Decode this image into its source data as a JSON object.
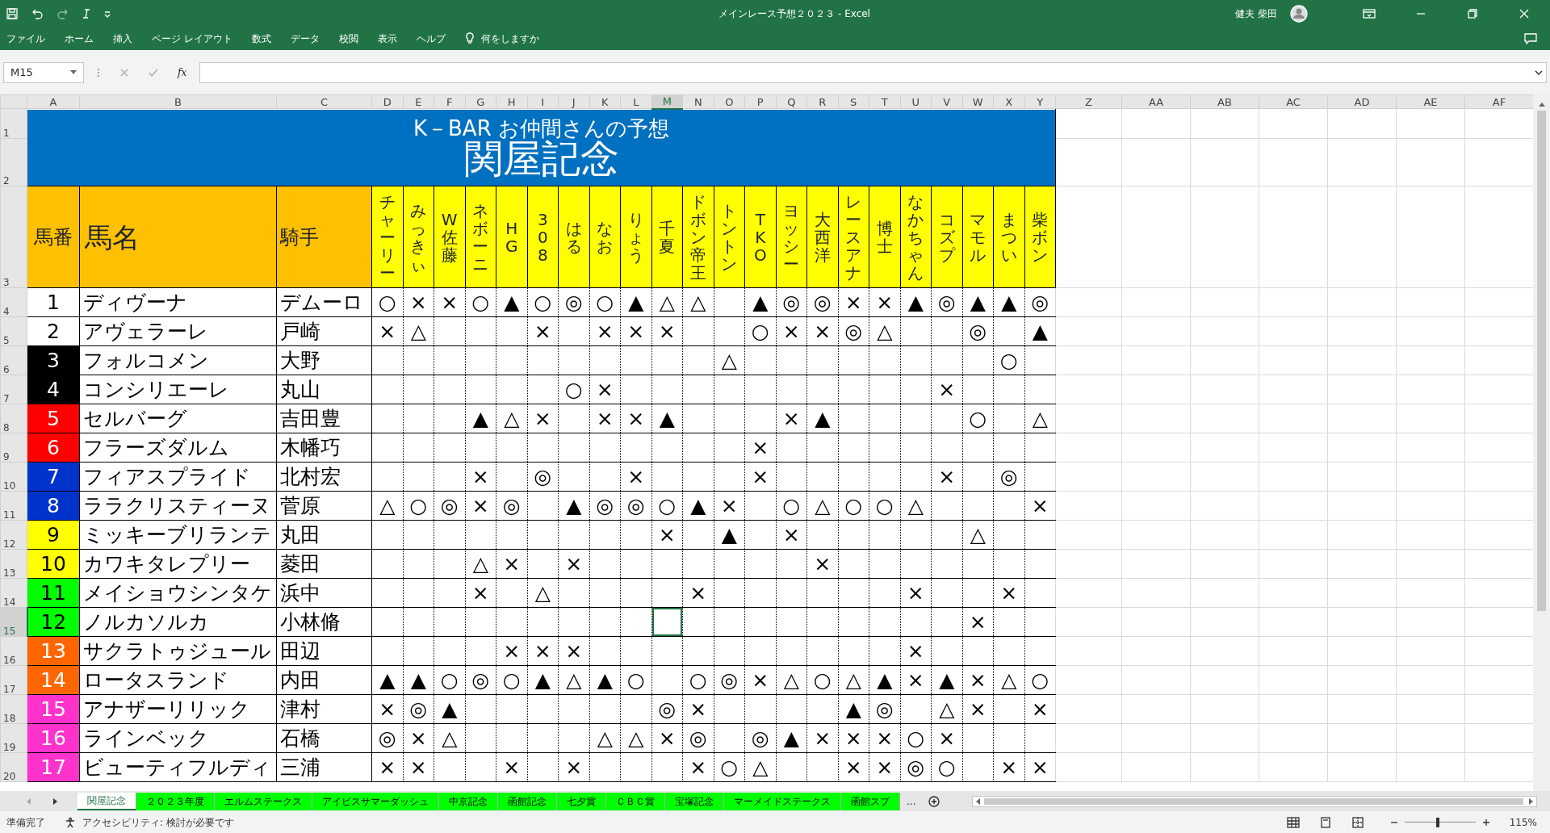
{
  "window": {
    "title": "メインレース予想２０２３ - Excel",
    "user": "健夫 柴田"
  },
  "ribbon_tabs": [
    "ファイル",
    "ホーム",
    "挿入",
    "ページ レイアウト",
    "数式",
    "データ",
    "校閲",
    "表示",
    "ヘルプ"
  ],
  "tell_me": "何をしますか",
  "name_box": "M15",
  "function_label": "fx",
  "columns": [
    {
      "label": "A",
      "selected": false
    },
    {
      "label": "B",
      "selected": false
    },
    {
      "label": "C",
      "selected": false
    },
    {
      "label": "D",
      "selected": false
    },
    {
      "label": "E",
      "selected": false
    },
    {
      "label": "F",
      "selected": false
    },
    {
      "label": "G",
      "selected": false
    },
    {
      "label": "H",
      "selected": false
    },
    {
      "label": "I",
      "selected": false
    },
    {
      "label": "J",
      "selected": false
    },
    {
      "label": "K",
      "selected": false
    },
    {
      "label": "L",
      "selected": false
    },
    {
      "label": "M",
      "selected": true
    },
    {
      "label": "N",
      "selected": false
    },
    {
      "label": "O",
      "selected": false
    },
    {
      "label": "P",
      "selected": false
    },
    {
      "label": "Q",
      "selected": false
    },
    {
      "label": "R",
      "selected": false
    },
    {
      "label": "S",
      "selected": false
    },
    {
      "label": "T",
      "selected": false
    },
    {
      "label": "U",
      "selected": false
    },
    {
      "label": "V",
      "selected": false
    },
    {
      "label": "W",
      "selected": false
    },
    {
      "label": "X",
      "selected": false
    },
    {
      "label": "Y",
      "selected": false
    },
    {
      "label": "Z",
      "selected": false
    },
    {
      "label": "AA",
      "selected": false
    },
    {
      "label": "AB",
      "selected": false
    },
    {
      "label": "AC",
      "selected": false
    },
    {
      "label": "AD",
      "selected": false
    },
    {
      "label": "AE",
      "selected": false
    },
    {
      "label": "AF",
      "selected": false
    }
  ],
  "rows": [
    {
      "label": "1",
      "selected": false
    },
    {
      "label": "2",
      "selected": false
    },
    {
      "label": "3",
      "selected": false
    },
    {
      "label": "4",
      "selected": false
    },
    {
      "label": "5",
      "selected": false
    },
    {
      "label": "6",
      "selected": false
    },
    {
      "label": "7",
      "selected": false
    },
    {
      "label": "8",
      "selected": false
    },
    {
      "label": "9",
      "selected": false
    },
    {
      "label": "10",
      "selected": false
    },
    {
      "label": "11",
      "selected": false
    },
    {
      "label": "12",
      "selected": false
    },
    {
      "label": "13",
      "selected": false
    },
    {
      "label": "14",
      "selected": false
    },
    {
      "label": "15",
      "selected": true
    },
    {
      "label": "16",
      "selected": false
    },
    {
      "label": "17",
      "selected": false
    },
    {
      "label": "18",
      "selected": false
    },
    {
      "label": "19",
      "selected": false
    },
    {
      "label": "20",
      "selected": false
    }
  ],
  "sheet": {
    "title": "K－BAR お仲間さんの予想",
    "subtitle": "関屋記念",
    "headers": {
      "number": "馬番",
      "name": "馬名",
      "jockey": "騎手"
    },
    "predictors": [
      "チャーリー",
      "みっきぃ",
      "W佐藤",
      "ネボーニ",
      "HG",
      "308",
      "はる",
      "なお",
      "りょう",
      "千夏",
      "ドボン帝王",
      "トントン",
      "TKO",
      "ヨッシー",
      "大西洋",
      "レースアナ",
      "博士",
      "なかちゃん",
      "コズプ",
      "マモル",
      "まつい",
      "柴ボン"
    ],
    "horses": [
      {
        "number": "1",
        "name": "ディヴーナ",
        "jockey": "デムーロ",
        "color": "#ffffff",
        "marks": [
          {
            "kind": "mark",
            "text": "○"
          },
          {
            "kind": "mark",
            "text": "×"
          },
          {
            "kind": "mark",
            "text": "×"
          },
          {
            "kind": "mark",
            "text": "○"
          },
          {
            "kind": "mark",
            "text": "▲"
          },
          {
            "kind": "mark",
            "text": "○"
          },
          {
            "kind": "mark",
            "text": "◎"
          },
          {
            "kind": "mark",
            "text": "○"
          },
          {
            "kind": "mark",
            "text": "▲"
          },
          {
            "kind": "mark",
            "text": "△"
          },
          {
            "kind": "mark",
            "text": "△"
          },
          {
            "kind": "blank"
          },
          {
            "kind": "mark",
            "text": "▲"
          },
          {
            "kind": "mark",
            "text": "◎"
          },
          {
            "kind": "mark",
            "text": "◎"
          },
          {
            "kind": "mark",
            "text": "×"
          },
          {
            "kind": "mark",
            "text": "×"
          },
          {
            "kind": "mark",
            "text": "▲"
          },
          {
            "kind": "mark",
            "text": "◎"
          },
          {
            "kind": "mark",
            "text": "▲"
          },
          {
            "kind": "mark",
            "text": "▲"
          },
          {
            "kind": "mark",
            "text": "◎"
          }
        ]
      },
      {
        "number": "2",
        "name": "アヴェラーレ",
        "jockey": "戸崎",
        "color": "#ffffff",
        "marks": [
          {
            "kind": "mark",
            "text": "×"
          },
          {
            "kind": "mark",
            "text": "△"
          },
          {
            "kind": "blank"
          },
          {
            "kind": "blank"
          },
          {
            "kind": "blank"
          },
          {
            "kind": "mark",
            "text": "×"
          },
          {
            "kind": "blank"
          },
          {
            "kind": "mark",
            "text": "×"
          },
          {
            "kind": "mark",
            "text": "×"
          },
          {
            "kind": "mark",
            "text": "×"
          },
          {
            "kind": "blank"
          },
          {
            "kind": "blank"
          },
          {
            "kind": "mark",
            "text": "○"
          },
          {
            "kind": "mark",
            "text": "×"
          },
          {
            "kind": "mark",
            "text": "×"
          },
          {
            "kind": "mark",
            "text": "◎"
          },
          {
            "kind": "mark",
            "text": "△"
          },
          {
            "kind": "blank"
          },
          {
            "kind": "blank"
          },
          {
            "kind": "mark",
            "text": "◎"
          },
          {
            "kind": "blank"
          },
          {
            "kind": "mark",
            "text": "▲"
          }
        ]
      },
      {
        "number": "3",
        "name": "フォルコメン",
        "jockey": "大野",
        "color": "#000000",
        "marks": [
          {
            "kind": "blank"
          },
          {
            "kind": "blank"
          },
          {
            "kind": "blank"
          },
          {
            "kind": "blank"
          },
          {
            "kind": "blank"
          },
          {
            "kind": "blank"
          },
          {
            "kind": "blank"
          },
          {
            "kind": "blank"
          },
          {
            "kind": "blank"
          },
          {
            "kind": "blank"
          },
          {
            "kind": "blank"
          },
          {
            "kind": "mark",
            "text": "△"
          },
          {
            "kind": "blank"
          },
          {
            "kind": "blank"
          },
          {
            "kind": "blank"
          },
          {
            "kind": "blank"
          },
          {
            "kind": "blank"
          },
          {
            "kind": "blank"
          },
          {
            "kind": "blank"
          },
          {
            "kind": "blank"
          },
          {
            "kind": "mark",
            "text": "○"
          },
          {
            "kind": "blank"
          }
        ]
      },
      {
        "number": "4",
        "name": "コンシリエーレ",
        "jockey": "丸山",
        "color": "#000000",
        "marks": [
          {
            "kind": "blank"
          },
          {
            "kind": "blank"
          },
          {
            "kind": "blank"
          },
          {
            "kind": "blank"
          },
          {
            "kind": "blank"
          },
          {
            "kind": "blank"
          },
          {
            "kind": "mark",
            "text": "○"
          },
          {
            "kind": "mark",
            "text": "×"
          },
          {
            "kind": "blank"
          },
          {
            "kind": "blank"
          },
          {
            "kind": "blank"
          },
          {
            "kind": "blank"
          },
          {
            "kind": "blank"
          },
          {
            "kind": "blank"
          },
          {
            "kind": "blank"
          },
          {
            "kind": "blank"
          },
          {
            "kind": "blank"
          },
          {
            "kind": "blank"
          },
          {
            "kind": "mark",
            "text": "×"
          },
          {
            "kind": "blank"
          },
          {
            "kind": "blank"
          },
          {
            "kind": "blank"
          }
        ]
      },
      {
        "number": "5",
        "name": "セルバーグ",
        "jockey": "吉田豊",
        "color": "#ff0000",
        "marks": [
          {
            "kind": "blank"
          },
          {
            "kind": "blank"
          },
          {
            "kind": "blank"
          },
          {
            "kind": "mark",
            "text": "▲"
          },
          {
            "kind": "mark",
            "text": "△"
          },
          {
            "kind": "mark",
            "text": "×"
          },
          {
            "kind": "blank"
          },
          {
            "kind": "mark",
            "text": "×"
          },
          {
            "kind": "mark",
            "text": "×"
          },
          {
            "kind": "mark",
            "text": "▲"
          },
          {
            "kind": "blank"
          },
          {
            "kind": "blank"
          },
          {
            "kind": "blank"
          },
          {
            "kind": "mark",
            "text": "×"
          },
          {
            "kind": "mark",
            "text": "▲"
          },
          {
            "kind": "blank"
          },
          {
            "kind": "blank"
          },
          {
            "kind": "blank"
          },
          {
            "kind": "blank"
          },
          {
            "kind": "mark",
            "text": "○"
          },
          {
            "kind": "blank"
          },
          {
            "kind": "mark",
            "text": "△"
          }
        ]
      },
      {
        "number": "6",
        "name": "フラーズダルム",
        "jockey": "木幡巧",
        "color": "#ff0000",
        "marks": [
          {
            "kind": "blank"
          },
          {
            "kind": "blank"
          },
          {
            "kind": "blank"
          },
          {
            "kind": "blank"
          },
          {
            "kind": "blank"
          },
          {
            "kind": "blank"
          },
          {
            "kind": "blank"
          },
          {
            "kind": "blank"
          },
          {
            "kind": "blank"
          },
          {
            "kind": "blank"
          },
          {
            "kind": "blank"
          },
          {
            "kind": "blank"
          },
          {
            "kind": "mark",
            "text": "×"
          },
          {
            "kind": "blank"
          },
          {
            "kind": "blank"
          },
          {
            "kind": "blank"
          },
          {
            "kind": "blank"
          },
          {
            "kind": "blank"
          },
          {
            "kind": "blank"
          },
          {
            "kind": "blank"
          },
          {
            "kind": "blank"
          },
          {
            "kind": "blank"
          }
        ]
      },
      {
        "number": "7",
        "name": "フィアスプライド",
        "jockey": "北村宏",
        "color": "#0033cc",
        "marks": [
          {
            "kind": "blank"
          },
          {
            "kind": "blank"
          },
          {
            "kind": "blank"
          },
          {
            "kind": "mark",
            "text": "×"
          },
          {
            "kind": "blank"
          },
          {
            "kind": "mark",
            "text": "◎"
          },
          {
            "kind": "blank"
          },
          {
            "kind": "blank"
          },
          {
            "kind": "mark",
            "text": "×"
          },
          {
            "kind": "blank"
          },
          {
            "kind": "blank"
          },
          {
            "kind": "blank"
          },
          {
            "kind": "mark",
            "text": "×"
          },
          {
            "kind": "blank"
          },
          {
            "kind": "blank"
          },
          {
            "kind": "blank"
          },
          {
            "kind": "blank"
          },
          {
            "kind": "blank"
          },
          {
            "kind": "mark",
            "text": "×"
          },
          {
            "kind": "blank"
          },
          {
            "kind": "mark",
            "text": "◎"
          },
          {
            "kind": "blank"
          }
        ]
      },
      {
        "number": "8",
        "name": "ララクリスティーヌ",
        "jockey": "菅原",
        "color": "#0033cc",
        "marks": [
          {
            "kind": "mark",
            "text": "△"
          },
          {
            "kind": "mark",
            "text": "○"
          },
          {
            "kind": "mark",
            "text": "◎"
          },
          {
            "kind": "mark",
            "text": "×"
          },
          {
            "kind": "mark",
            "text": "◎"
          },
          {
            "kind": "blank"
          },
          {
            "kind": "mark",
            "text": "▲"
          },
          {
            "kind": "mark",
            "text": "◎"
          },
          {
            "kind": "mark",
            "text": "◎"
          },
          {
            "kind": "mark",
            "text": "○"
          },
          {
            "kind": "mark",
            "text": "▲"
          },
          {
            "kind": "mark",
            "text": "×"
          },
          {
            "kind": "blank"
          },
          {
            "kind": "mark",
            "text": "○"
          },
          {
            "kind": "mark",
            "text": "△"
          },
          {
            "kind": "mark",
            "text": "○"
          },
          {
            "kind": "mark",
            "text": "○"
          },
          {
            "kind": "mark",
            "text": "△"
          },
          {
            "kind": "blank"
          },
          {
            "kind": "blank"
          },
          {
            "kind": "blank"
          },
          {
            "kind": "mark",
            "text": "×"
          }
        ]
      },
      {
        "number": "9",
        "name": "ミッキーブリランテ",
        "jockey": "丸田",
        "color": "#ffff00",
        "marks": [
          {
            "kind": "blank"
          },
          {
            "kind": "blank"
          },
          {
            "kind": "blank"
          },
          {
            "kind": "blank"
          },
          {
            "kind": "blank"
          },
          {
            "kind": "blank"
          },
          {
            "kind": "blank"
          },
          {
            "kind": "blank"
          },
          {
            "kind": "blank"
          },
          {
            "kind": "mark",
            "text": "×"
          },
          {
            "kind": "blank"
          },
          {
            "kind": "mark",
            "text": "▲"
          },
          {
            "kind": "blank"
          },
          {
            "kind": "mark",
            "text": "×"
          },
          {
            "kind": "blank"
          },
          {
            "kind": "blank"
          },
          {
            "kind": "blank"
          },
          {
            "kind": "blank"
          },
          {
            "kind": "blank"
          },
          {
            "kind": "mark",
            "text": "△"
          },
          {
            "kind": "blank"
          },
          {
            "kind": "blank"
          }
        ]
      },
      {
        "number": "10",
        "name": "カワキタレプリー",
        "jockey": "菱田",
        "color": "#ffff00",
        "marks": [
          {
            "kind": "blank"
          },
          {
            "kind": "blank"
          },
          {
            "kind": "blank"
          },
          {
            "kind": "mark",
            "text": "△"
          },
          {
            "kind": "mark",
            "text": "×"
          },
          {
            "kind": "blank"
          },
          {
            "kind": "mark",
            "text": "×"
          },
          {
            "kind": "blank"
          },
          {
            "kind": "blank"
          },
          {
            "kind": "blank"
          },
          {
            "kind": "blank"
          },
          {
            "kind": "blank"
          },
          {
            "kind": "blank"
          },
          {
            "kind": "blank"
          },
          {
            "kind": "mark",
            "text": "×"
          },
          {
            "kind": "blank"
          },
          {
            "kind": "blank"
          },
          {
            "kind": "blank"
          },
          {
            "kind": "blank"
          },
          {
            "kind": "blank"
          },
          {
            "kind": "blank"
          },
          {
            "kind": "blank"
          }
        ]
      },
      {
        "number": "11",
        "name": "メイショウシンタケ",
        "jockey": "浜中",
        "color": "#00ff00",
        "marks": [
          {
            "kind": "blank"
          },
          {
            "kind": "blank"
          },
          {
            "kind": "blank"
          },
          {
            "kind": "mark",
            "text": "×"
          },
          {
            "kind": "blank"
          },
          {
            "kind": "mark",
            "text": "△"
          },
          {
            "kind": "blank"
          },
          {
            "kind": "blank"
          },
          {
            "kind": "blank"
          },
          {
            "kind": "blank"
          },
          {
            "kind": "mark",
            "text": "×"
          },
          {
            "kind": "blank"
          },
          {
            "kind": "blank"
          },
          {
            "kind": "blank"
          },
          {
            "kind": "blank"
          },
          {
            "kind": "blank"
          },
          {
            "kind": "blank"
          },
          {
            "kind": "mark",
            "text": "×"
          },
          {
            "kind": "blank"
          },
          {
            "kind": "blank"
          },
          {
            "kind": "mark",
            "text": "×"
          },
          {
            "kind": "blank"
          }
        ]
      },
      {
        "number": "12",
        "name": "ノルカソルカ",
        "jockey": "小林脩",
        "color": "#00ff00",
        "marks": [
          {
            "kind": "blank"
          },
          {
            "kind": "blank"
          },
          {
            "kind": "blank"
          },
          {
            "kind": "blank"
          },
          {
            "kind": "blank"
          },
          {
            "kind": "blank"
          },
          {
            "kind": "blank"
          },
          {
            "kind": "blank"
          },
          {
            "kind": "blank"
          },
          {
            "kind": "blank"
          },
          {
            "kind": "blank"
          },
          {
            "kind": "blank"
          },
          {
            "kind": "blank"
          },
          {
            "kind": "blank"
          },
          {
            "kind": "blank"
          },
          {
            "kind": "blank"
          },
          {
            "kind": "blank"
          },
          {
            "kind": "blank"
          },
          {
            "kind": "blank"
          },
          {
            "kind": "mark",
            "text": "×"
          },
          {
            "kind": "blank"
          },
          {
            "kind": "blank"
          }
        ]
      },
      {
        "number": "13",
        "name": "サクラトゥジュール",
        "jockey": "田辺",
        "color": "#ff6600",
        "marks": [
          {
            "kind": "blank"
          },
          {
            "kind": "blank"
          },
          {
            "kind": "blank"
          },
          {
            "kind": "blank"
          },
          {
            "kind": "mark",
            "text": "×"
          },
          {
            "kind": "mark",
            "text": "×"
          },
          {
            "kind": "mark",
            "text": "×"
          },
          {
            "kind": "blank"
          },
          {
            "kind": "blank"
          },
          {
            "kind": "blank"
          },
          {
            "kind": "blank"
          },
          {
            "kind": "blank"
          },
          {
            "kind": "blank"
          },
          {
            "kind": "blank"
          },
          {
            "kind": "blank"
          },
          {
            "kind": "blank"
          },
          {
            "kind": "blank"
          },
          {
            "kind": "mark",
            "text": "×"
          },
          {
            "kind": "blank"
          },
          {
            "kind": "blank"
          },
          {
            "kind": "blank"
          },
          {
            "kind": "blank"
          }
        ]
      },
      {
        "number": "14",
        "name": "ロータスランド",
        "jockey": "内田",
        "color": "#ff6600",
        "marks": [
          {
            "kind": "mark",
            "text": "▲"
          },
          {
            "kind": "mark",
            "text": "▲"
          },
          {
            "kind": "mark",
            "text": "○"
          },
          {
            "kind": "mark",
            "text": "◎"
          },
          {
            "kind": "mark",
            "text": "○"
          },
          {
            "kind": "mark",
            "text": "▲"
          },
          {
            "kind": "mark",
            "text": "△"
          },
          {
            "kind": "mark",
            "text": "▲"
          },
          {
            "kind": "mark",
            "text": "○"
          },
          {
            "kind": "blank"
          },
          {
            "kind": "mark",
            "text": "○"
          },
          {
            "kind": "mark",
            "text": "◎"
          },
          {
            "kind": "mark",
            "text": "×"
          },
          {
            "kind": "mark",
            "text": "△"
          },
          {
            "kind": "mark",
            "text": "○"
          },
          {
            "kind": "mark",
            "text": "△"
          },
          {
            "kind": "mark",
            "text": "▲"
          },
          {
            "kind": "mark",
            "text": "×"
          },
          {
            "kind": "mark",
            "text": "▲"
          },
          {
            "kind": "mark",
            "text": "×"
          },
          {
            "kind": "mark",
            "text": "△"
          },
          {
            "kind": "mark",
            "text": "○"
          }
        ]
      },
      {
        "number": "15",
        "name": "アナザーリリック",
        "jockey": "津村",
        "color": "#ff33cc",
        "marks": [
          {
            "kind": "mark",
            "text": "×"
          },
          {
            "kind": "mark",
            "text": "◎"
          },
          {
            "kind": "mark",
            "text": "▲"
          },
          {
            "kind": "blank"
          },
          {
            "kind": "blank"
          },
          {
            "kind": "blank"
          },
          {
            "kind": "blank"
          },
          {
            "kind": "blank"
          },
          {
            "kind": "blank"
          },
          {
            "kind": "mark",
            "text": "◎"
          },
          {
            "kind": "mark",
            "text": "×"
          },
          {
            "kind": "blank"
          },
          {
            "kind": "blank"
          },
          {
            "kind": "blank"
          },
          {
            "kind": "blank"
          },
          {
            "kind": "mark",
            "text": "▲"
          },
          {
            "kind": "mark",
            "text": "◎"
          },
          {
            "kind": "blank"
          },
          {
            "kind": "mark",
            "text": "△"
          },
          {
            "kind": "mark",
            "text": "×"
          },
          {
            "kind": "blank"
          },
          {
            "kind": "mark",
            "text": "×"
          }
        ]
      },
      {
        "number": "16",
        "name": "ラインベック",
        "jockey": "石橋",
        "color": "#ff33cc",
        "marks": [
          {
            "kind": "mark",
            "text": "◎"
          },
          {
            "kind": "mark",
            "text": "×"
          },
          {
            "kind": "mark",
            "text": "△"
          },
          {
            "kind": "blank"
          },
          {
            "kind": "blank"
          },
          {
            "kind": "blank"
          },
          {
            "kind": "blank"
          },
          {
            "kind": "mark",
            "text": "△"
          },
          {
            "kind": "mark",
            "text": "△"
          },
          {
            "kind": "mark",
            "text": "×"
          },
          {
            "kind": "mark",
            "text": "◎"
          },
          {
            "kind": "blank"
          },
          {
            "kind": "mark",
            "text": "◎"
          },
          {
            "kind": "mark",
            "text": "▲"
          },
          {
            "kind": "mark",
            "text": "×"
          },
          {
            "kind": "mark",
            "text": "×"
          },
          {
            "kind": "mark",
            "text": "×"
          },
          {
            "kind": "mark",
            "text": "○"
          },
          {
            "kind": "mark",
            "text": "×"
          },
          {
            "kind": "blank"
          },
          {
            "kind": "blank"
          },
          {
            "kind": "blank"
          }
        ]
      },
      {
        "number": "17",
        "name": "ビューティフルディ",
        "jockey": "三浦",
        "color": "#ff33cc",
        "marks": [
          {
            "kind": "mark",
            "text": "×"
          },
          {
            "kind": "mark",
            "text": "×"
          },
          {
            "kind": "blank"
          },
          {
            "kind": "blank"
          },
          {
            "kind": "mark",
            "text": "×"
          },
          {
            "kind": "blank"
          },
          {
            "kind": "mark",
            "text": "×"
          },
          {
            "kind": "blank"
          },
          {
            "kind": "blank"
          },
          {
            "kind": "blank"
          },
          {
            "kind": "mark",
            "text": "×"
          },
          {
            "kind": "mark",
            "text": "○"
          },
          {
            "kind": "mark",
            "text": "△"
          },
          {
            "kind": "blank"
          },
          {
            "kind": "blank"
          },
          {
            "kind": "mark",
            "text": "×"
          },
          {
            "kind": "mark",
            "text": "×"
          },
          {
            "kind": "mark",
            "text": "◎"
          },
          {
            "kind": "mark",
            "text": "○"
          },
          {
            "kind": "blank"
          },
          {
            "kind": "mark",
            "text": "×"
          },
          {
            "kind": "mark",
            "text": "×"
          }
        ]
      }
    ]
  },
  "sheet_tabs": [
    {
      "label": "関屋記念",
      "selected": true
    },
    {
      "label": "２０２３年度",
      "selected": false
    },
    {
      "label": "エルムステークス",
      "selected": false
    },
    {
      "label": "アイビスサマーダッシュ",
      "selected": false
    },
    {
      "label": "中京記念",
      "selected": false
    },
    {
      "label": "函館記念",
      "selected": false
    },
    {
      "label": "七夕賞",
      "selected": false
    },
    {
      "label": "ＣＢＣ賞",
      "selected": false
    },
    {
      "label": "宝塚記念",
      "selected": false
    },
    {
      "label": "マーメイドステークス",
      "selected": false
    },
    {
      "label": "函館スプ",
      "selected": false
    }
  ],
  "tabs_overflow": "...",
  "status_bar": {
    "status": "準備完了",
    "accessibility": "アクセシビリティ: 検討が必要です",
    "zoom": "115%",
    "zoom_slider": {
      "level": 0.47
    }
  }
}
